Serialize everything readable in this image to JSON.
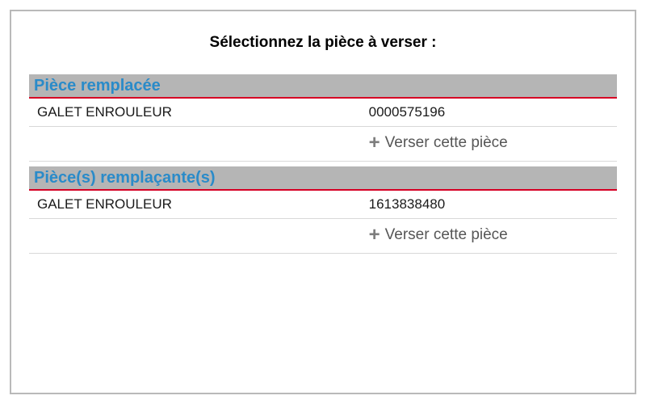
{
  "title": "Sélectionnez la pièce à verser :",
  "sections": [
    {
      "header": "Pièce remplacée",
      "item": {
        "name": "GALET ENROULEUR",
        "code": "0000575196"
      },
      "action_label": "Verser cette pièce"
    },
    {
      "header": "Pièce(s) remplaçante(s)",
      "item": {
        "name": "GALET ENROULEUR",
        "code": "1613838480"
      },
      "action_label": "Verser cette pièce"
    }
  ]
}
